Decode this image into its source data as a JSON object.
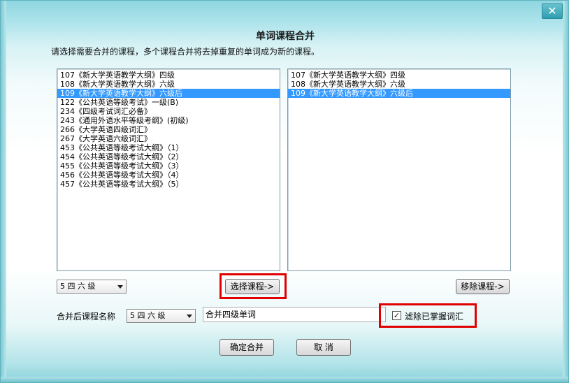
{
  "window": {
    "close_symbol": "✕",
    "title": "单词课程合并",
    "instruction": "请选择需要合并的课程，多个课程合并将去掉重复的单词成为新的课程。"
  },
  "left_list": {
    "items": [
      {
        "label": "107《新大学英语教学大纲》四级",
        "selected": false
      },
      {
        "label": "108《新大学英语教学大纲》六级",
        "selected": false
      },
      {
        "label": "109《新大学英语教学大纲》六级后",
        "selected": true
      },
      {
        "label": "122《公共英语等级考试》一级(B)",
        "selected": false
      },
      {
        "label": "234《四级考试词汇必备》",
        "selected": false
      },
      {
        "label": "243《通用外语水平等级考纲》(初级)",
        "selected": false
      },
      {
        "label": "266《大学英语四级词汇》",
        "selected": false
      },
      {
        "label": "267《大学英语六级词汇》",
        "selected": false
      },
      {
        "label": "453《公共英语等级考试大纲》（1）",
        "selected": false
      },
      {
        "label": "454《公共英语等级考试大纲》（2）",
        "selected": false
      },
      {
        "label": "455《公共英语等级考试大纲》（3）",
        "selected": false
      },
      {
        "label": "456《公共英语等级考试大纲》（4）",
        "selected": false
      },
      {
        "label": "457《公共英语等级考试大纲》（5）",
        "selected": false
      }
    ]
  },
  "right_list": {
    "items": [
      {
        "label": "107《新大学英语教学大纲》四级",
        "selected": false
      },
      {
        "label": "108《新大学英语教学大纲》六级",
        "selected": false
      },
      {
        "label": "109《新大学英语教学大纲》六级后",
        "selected": true
      }
    ]
  },
  "category_combo": {
    "value": "5 四 六 级"
  },
  "select_button": {
    "label": "选择课程->"
  },
  "remove_button": {
    "label": "移除课程->"
  },
  "merged_name": {
    "label": "合并后课程名称",
    "combo_value": "5 四 六 级",
    "input_value": "合并四级单词"
  },
  "filter_checkbox": {
    "checked_mark": "✓",
    "label": "滤除已掌握词汇"
  },
  "confirm_button": {
    "label": "确定合并"
  },
  "cancel_button": {
    "label": "取 消"
  },
  "colors": {
    "selection": "#3399ff",
    "highlight_box": "#e00000"
  }
}
